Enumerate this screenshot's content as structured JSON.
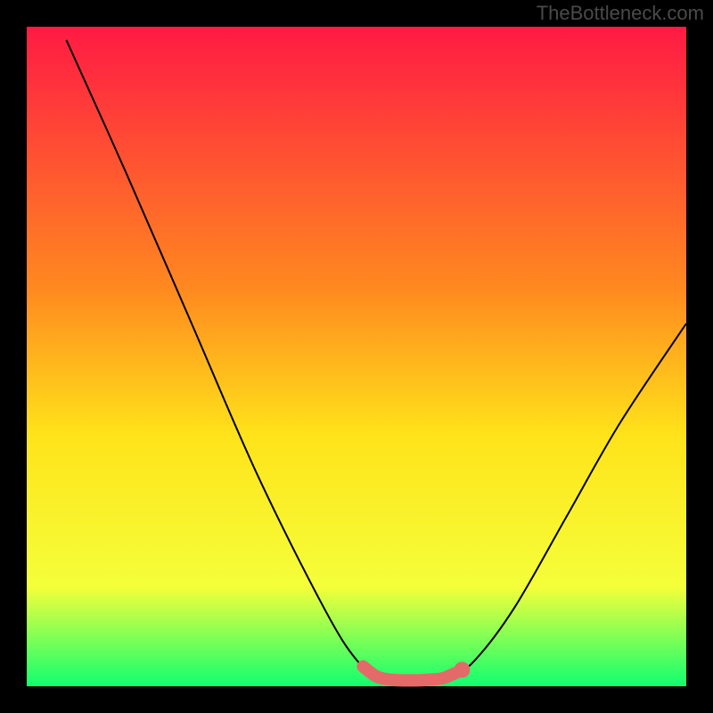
{
  "attribution": "TheBottleneck.com",
  "chart_data": {
    "type": "line",
    "title": "",
    "xlabel": "",
    "ylabel": "",
    "xlim": [
      0,
      100
    ],
    "ylim": [
      0,
      100
    ],
    "series": [
      {
        "name": "bottleneck-curve",
        "type": "line",
        "points": [
          [
            6,
            98
          ],
          [
            15,
            78
          ],
          [
            25,
            55
          ],
          [
            35,
            32
          ],
          [
            45,
            12
          ],
          [
            50,
            4
          ],
          [
            54,
            1
          ],
          [
            60,
            1
          ],
          [
            64,
            1.2
          ],
          [
            68,
            4
          ],
          [
            74,
            12
          ],
          [
            82,
            26
          ],
          [
            90,
            40
          ],
          [
            100,
            55
          ]
        ]
      },
      {
        "name": "optimal-segment",
        "type": "line",
        "points": [
          [
            51,
            3.0
          ],
          [
            53,
            1.5
          ],
          [
            55,
            1.0
          ],
          [
            57,
            0.9
          ],
          [
            59,
            0.9
          ],
          [
            61,
            1.0
          ],
          [
            63,
            1.2
          ],
          [
            65,
            2.0
          ]
        ]
      },
      {
        "name": "marker-dot",
        "type": "scatter",
        "points": [
          [
            66,
            2.5
          ]
        ]
      }
    ],
    "colors": {
      "gradient_top": "#ff1a44",
      "gradient_mid1": "#ff8a1f",
      "gradient_mid2": "#ffe31a",
      "gradient_mid3": "#f4ff3a",
      "gradient_bottom": "#10ff70",
      "curve": "#000000",
      "optimal_segment": "#e46a6a",
      "marker_dot": "#e46a6a",
      "attribution_text": "#4a4a4a"
    }
  }
}
